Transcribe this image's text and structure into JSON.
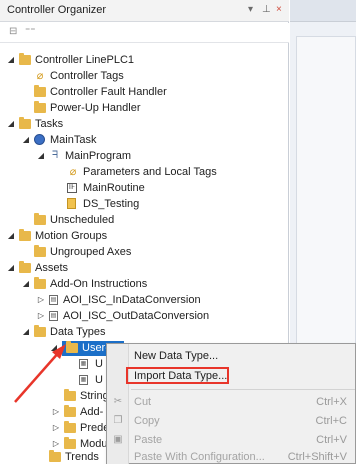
{
  "panel": {
    "title": "Controller Organizer",
    "controls": {
      "pin": "▾",
      "dock": "⊥",
      "close": "×"
    }
  },
  "toolbar": {
    "icon_a": "⊟",
    "icon_b": "⁼⁼"
  },
  "tree": {
    "controller": "Controller LinePLC1",
    "controller_tags": "Controller Tags",
    "controller_fault_handler": "Controller Fault Handler",
    "power_up_handler": "Power-Up Handler",
    "tasks": "Tasks",
    "main_task": "MainTask",
    "main_program": "MainProgram",
    "parameters_local_tags": "Parameters and Local Tags",
    "main_routine": "MainRoutine",
    "ds_testing": "DS_Testing",
    "unscheduled": "Unscheduled",
    "motion_groups": "Motion Groups",
    "ungrouped_axes": "Ungrouped Axes",
    "assets": "Assets",
    "add_on_instructions": "Add-On Instructions",
    "aoi_in": "AOI_ISC_InDataConversion",
    "aoi_out": "AOI_ISC_OutDataConversion",
    "data_types": "Data Types",
    "user_defined": "User-",
    "ud_child_1": "U",
    "ud_child_2": "U",
    "strings": "String",
    "add_on_defined": "Add-",
    "predefined": "Prede",
    "module_defined": "Modu",
    "trends": "Trends"
  },
  "context_menu": {
    "new_data_type": "New Data Type...",
    "import_data_type": "Import Data Type...",
    "cut": "Cut",
    "cut_key": "Ctrl+X",
    "copy": "Copy",
    "copy_key": "Ctrl+C",
    "paste": "Paste",
    "paste_key": "Ctrl+V",
    "paste_with_config": "Paste With Configuration...",
    "paste_with_config_key": "Ctrl+Shift+V"
  },
  "colors": {
    "selection": "#1b6fc8",
    "highlight": "#e8352a",
    "arrow": "#e8352a",
    "folder": "#e8b84a"
  }
}
